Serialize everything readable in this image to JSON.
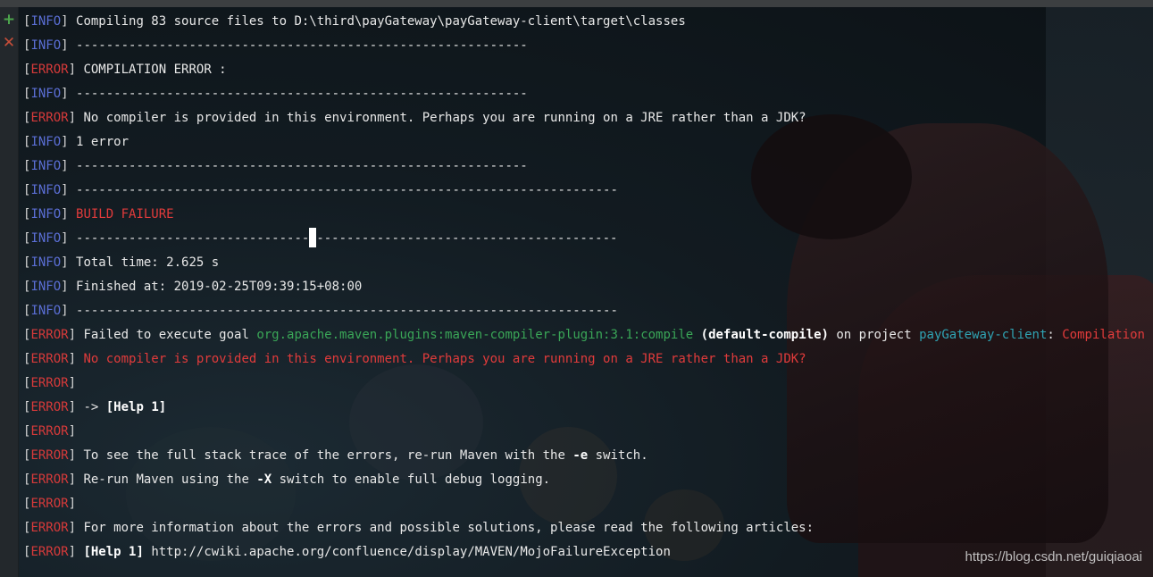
{
  "gutter": {
    "add_icon": "+",
    "close_icon": "✕"
  },
  "levels": {
    "info": "INFO",
    "error": "ERROR"
  },
  "lines": {
    "l0": {
      "text": "Compiling 83 source files to D:\\third\\payGateway\\payGateway-client\\target\\classes"
    },
    "l1": {
      "text": "------------------------------------------------------------"
    },
    "l2": {
      "text": "COMPILATION ERROR :"
    },
    "l3": {
      "text": "------------------------------------------------------------"
    },
    "l4": {
      "text": "No compiler is provided in this environment. Perhaps you are running on a JRE rather than a JDK?"
    },
    "l5": {
      "text": "1 error"
    },
    "l6": {
      "text": "------------------------------------------------------------"
    },
    "l7": {
      "text": "------------------------------------------------------------------------"
    },
    "l8": {
      "text": "BUILD FAILURE"
    },
    "l9": {
      "text_a": "-------------------------------",
      "text_b": "----------------------------------------"
    },
    "l10": {
      "text": "Total time: 2.625 s"
    },
    "l11": {
      "text": "Finished at: 2019-02-25T09:39:15+08:00"
    },
    "l12": {
      "text": "------------------------------------------------------------------------"
    },
    "l13": {
      "t1": "Failed to execute goal ",
      "goal": "org.apache.maven.plugins:maven-compiler-plugin:3.1:compile",
      "exec": "(default-compile)",
      "t2": " on project ",
      "project": "payGateway-client",
      "t3": ": ",
      "failure": "Compilation failure"
    },
    "l14": {
      "text": "No compiler is provided in this environment. Perhaps you are running on a JRE rather than a JDK?"
    },
    "l15": {
      "text": ""
    },
    "l16": {
      "arrow": "-> ",
      "help": "[Help 1]"
    },
    "l17": {
      "text": ""
    },
    "l18": {
      "t1": "To see the full stack trace of the errors, re-run Maven with the ",
      "flag": "-e",
      "t2": " switch."
    },
    "l19": {
      "t1": "Re-run Maven using the ",
      "flag": "-X",
      "t2": " switch to enable full debug logging."
    },
    "l20": {
      "text": ""
    },
    "l21": {
      "text": "For more information about the errors and possible solutions, please read the following articles:"
    },
    "l22": {
      "help": "[Help 1]",
      "url": " http://cwiki.apache.org/confluence/display/MAVEN/MojoFailureException"
    }
  },
  "watermark": "https://blog.csdn.net/guiqiaoai",
  "colors": {
    "info": "#5b6fd6",
    "error": "#d63a3a",
    "goal": "#3aa657",
    "project": "#2fa3b3"
  }
}
